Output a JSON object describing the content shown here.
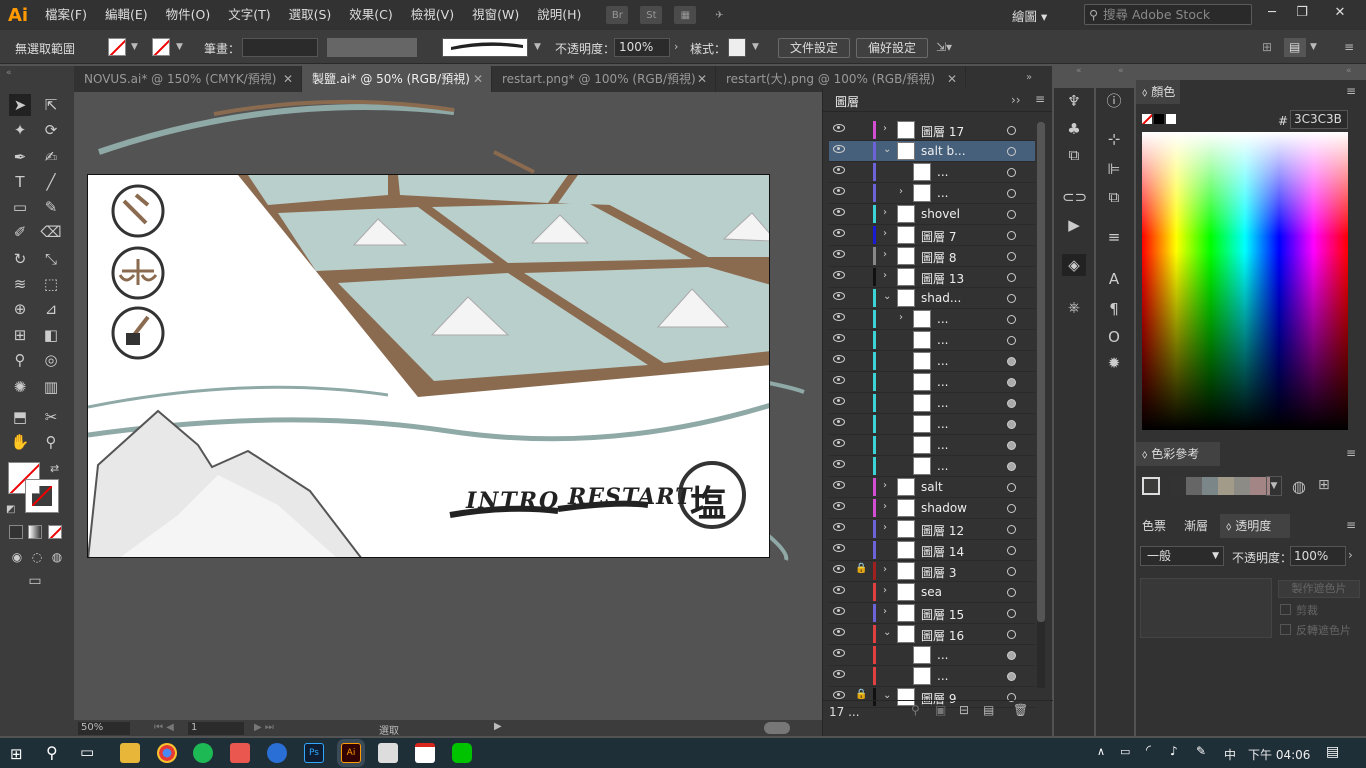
{
  "app": {
    "logo": "Ai",
    "menu": [
      "檔案(F)",
      "編輯(E)",
      "物件(O)",
      "文字(T)",
      "選取(S)",
      "效果(C)",
      "檢視(V)",
      "視窗(W)",
      "說明(H)"
    ],
    "br": "Br",
    "st": "St",
    "workspace": "繪圖",
    "search_placeholder": "搜尋 Adobe Stock"
  },
  "control": {
    "selection": "無選取範圍",
    "stroke_label": "筆畫：",
    "opacity_label": "不透明度：",
    "opacity_value": "100%",
    "style_label": "樣式：",
    "doc_setup": "文件設定",
    "prefs": "偏好設定"
  },
  "tabs": [
    {
      "label": "NOVUS.ai* @ 150% (CMYK/預視)"
    },
    {
      "label": "製鹽.ai* @ 50% (RGB/預視)"
    },
    {
      "label": "restart.png* @ 100% (RGB/預視)"
    },
    {
      "label": "restart(大).png @ 100% (RGB/預視)"
    }
  ],
  "artboard": {
    "intro": "INTRO",
    "restart": "RESTART",
    "seal": "塩"
  },
  "status": {
    "zoom": "50%",
    "page": "1",
    "mode": "選取"
  },
  "layers": {
    "title": "圖層",
    "count": "17 ...",
    "rows": [
      {
        "name": "圖層 17",
        "color": "#d24fd4",
        "level": 0,
        "tw": ">",
        "tgt": false
      },
      {
        "name": "salt b...",
        "color": "#6b63d6",
        "level": 0,
        "tw": "v",
        "sel": true,
        "tgt": false
      },
      {
        "name": "...",
        "color": "#6b63d6",
        "level": 1,
        "tw": "",
        "tgt": false
      },
      {
        "name": "...",
        "color": "#6b63d6",
        "level": 1,
        "tw": ">",
        "tgt": false
      },
      {
        "name": "shovel",
        "color": "#3cd3d6",
        "level": 0,
        "tw": ">",
        "tgt": false
      },
      {
        "name": "圖層 7",
        "color": "#1b1bd6",
        "level": 0,
        "tw": ">",
        "tgt": false
      },
      {
        "name": "圖層 8",
        "color": "#888888",
        "level": 0,
        "tw": ">",
        "tgt": false
      },
      {
        "name": "圖層 13",
        "color": "#111111",
        "level": 0,
        "tw": ">",
        "tgt": false
      },
      {
        "name": "shad...",
        "color": "#3cd3d6",
        "level": 0,
        "tw": "v",
        "tgt": false
      },
      {
        "name": "...",
        "color": "#3cd3d6",
        "level": 1,
        "tw": ">",
        "tgt": false
      },
      {
        "name": "...",
        "color": "#3cd3d6",
        "level": 1,
        "tw": "",
        "tgt": false
      },
      {
        "name": "...",
        "color": "#3cd3d6",
        "level": 1,
        "tw": "",
        "tgt": true
      },
      {
        "name": "...",
        "color": "#3cd3d6",
        "level": 1,
        "tw": "",
        "tgt": true
      },
      {
        "name": "...",
        "color": "#3cd3d6",
        "level": 1,
        "tw": "",
        "tgt": true
      },
      {
        "name": "...",
        "color": "#3cd3d6",
        "level": 1,
        "tw": "",
        "tgt": true
      },
      {
        "name": "...",
        "color": "#3cd3d6",
        "level": 1,
        "tw": "",
        "tgt": true
      },
      {
        "name": "...",
        "color": "#3cd3d6",
        "level": 1,
        "tw": "",
        "tgt": true
      },
      {
        "name": "salt",
        "color": "#d24fd4",
        "level": 0,
        "tw": ">",
        "tgt": false
      },
      {
        "name": "shadow",
        "color": "#d24fd4",
        "level": 0,
        "tw": ">",
        "tgt": false
      },
      {
        "name": "圖層 12",
        "color": "#6b63d6",
        "level": 0,
        "tw": ">",
        "tgt": false
      },
      {
        "name": "圖層 14",
        "color": "#6b63d6",
        "level": 0,
        "tw": "",
        "tgt": false
      },
      {
        "name": "圖層 3",
        "color": "#a02020",
        "level": 0,
        "tw": ">",
        "lock": true,
        "tgt": false
      },
      {
        "name": "sea",
        "color": "#e04040",
        "level": 0,
        "tw": ">",
        "tgt": false
      },
      {
        "name": "圖層 15",
        "color": "#6b63d6",
        "level": 0,
        "tw": ">",
        "tgt": false
      },
      {
        "name": "圖層 16",
        "color": "#e04040",
        "level": 0,
        "tw": "v",
        "tgt": false
      },
      {
        "name": "...",
        "color": "#e04040",
        "level": 1,
        "tw": "",
        "tgt": true
      },
      {
        "name": "...",
        "color": "#e04040",
        "level": 1,
        "tw": "",
        "tgt": true
      },
      {
        "name": "圖層 9",
        "color": "#111111",
        "level": 0,
        "tw": "v",
        "lock": true,
        "tgt": false
      }
    ]
  },
  "color": {
    "title": "顏色",
    "hex_label": "#",
    "hex": "3C3C3B"
  },
  "guide": {
    "title": "色彩參考"
  },
  "transparency": {
    "tabs": [
      "色票",
      "漸層",
      "透明度"
    ],
    "mode": "一般",
    "opacity_label": "不透明度：",
    "opacity": "100%",
    "make_mask": "製作遮色片",
    "clip": "剪裁",
    "invert": "反轉遮色片"
  },
  "taskbar": {
    "ime": "中",
    "time": "下午 04:06"
  },
  "colors": {
    "accent": "#ff9a00",
    "selection": "#46607b",
    "pond": "#b9cfcc",
    "path": "#8b6b4f"
  }
}
